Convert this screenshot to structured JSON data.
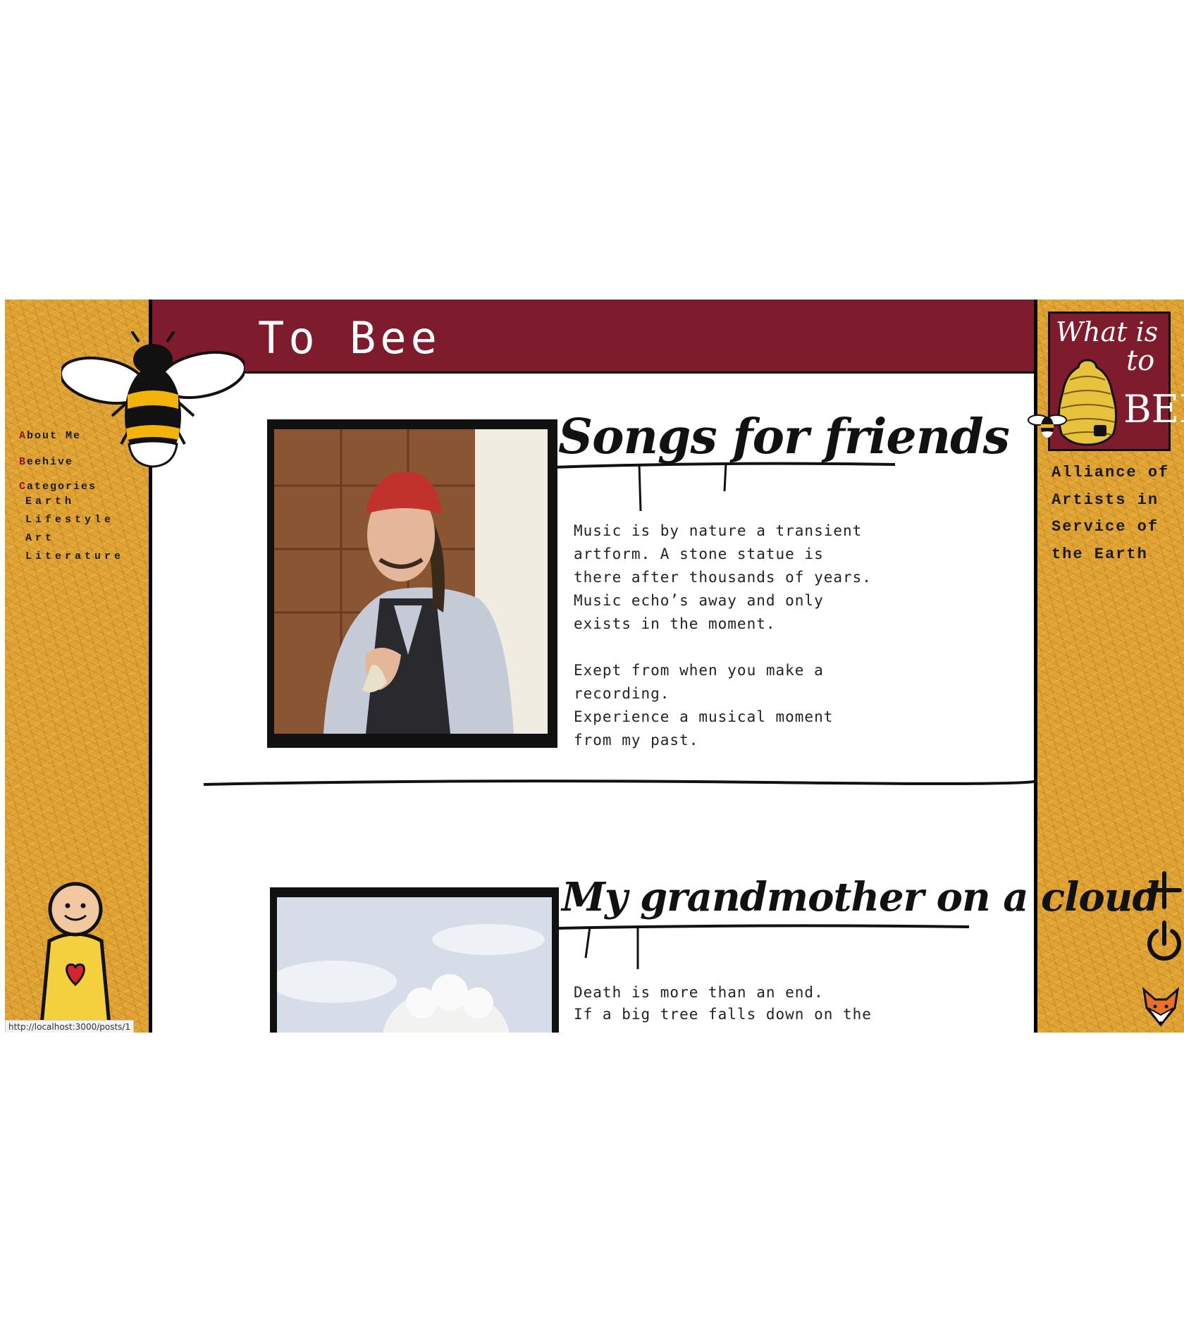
{
  "header": {
    "title": "To Bee"
  },
  "nav": {
    "about": {
      "first": "A",
      "rest": "bout Me"
    },
    "beehive": {
      "first": "B",
      "rest": "eehive"
    },
    "categories": {
      "first": "C",
      "rest": "ategories"
    },
    "subcategories": [
      "Earth",
      "Lifestyle",
      "Art",
      "Literature"
    ]
  },
  "logo": {
    "line1": "What is",
    "line2": "to",
    "line3": "BEE"
  },
  "tagline": [
    "Alliance of",
    "Artists in",
    "Service of",
    "the Earth"
  ],
  "posts": [
    {
      "title": "Songs for friends",
      "body": "Music is by nature a transient\nartform. A stone statue is\nthere after thousands of years.\nMusic echo’s away and only\nexists in the moment.\n\nExept from when you make a\nrecording.\nExperience a musical moment\nfrom my past."
    },
    {
      "title": "My grandmother on a cloud",
      "body": "Death is more than an end.\nIf a big tree falls down on the"
    }
  ],
  "status_bar": {
    "url": "http://localhost:3000/posts/1"
  },
  "icons": {
    "add": "plus-icon",
    "logout": "power-icon",
    "fox": "fox-icon",
    "bee": "bee-icon",
    "person": "person-heart-icon"
  },
  "colors": {
    "header": "#7e1b2c",
    "panel": "#e0a232",
    "nav_initial": "#8b1a1a"
  }
}
